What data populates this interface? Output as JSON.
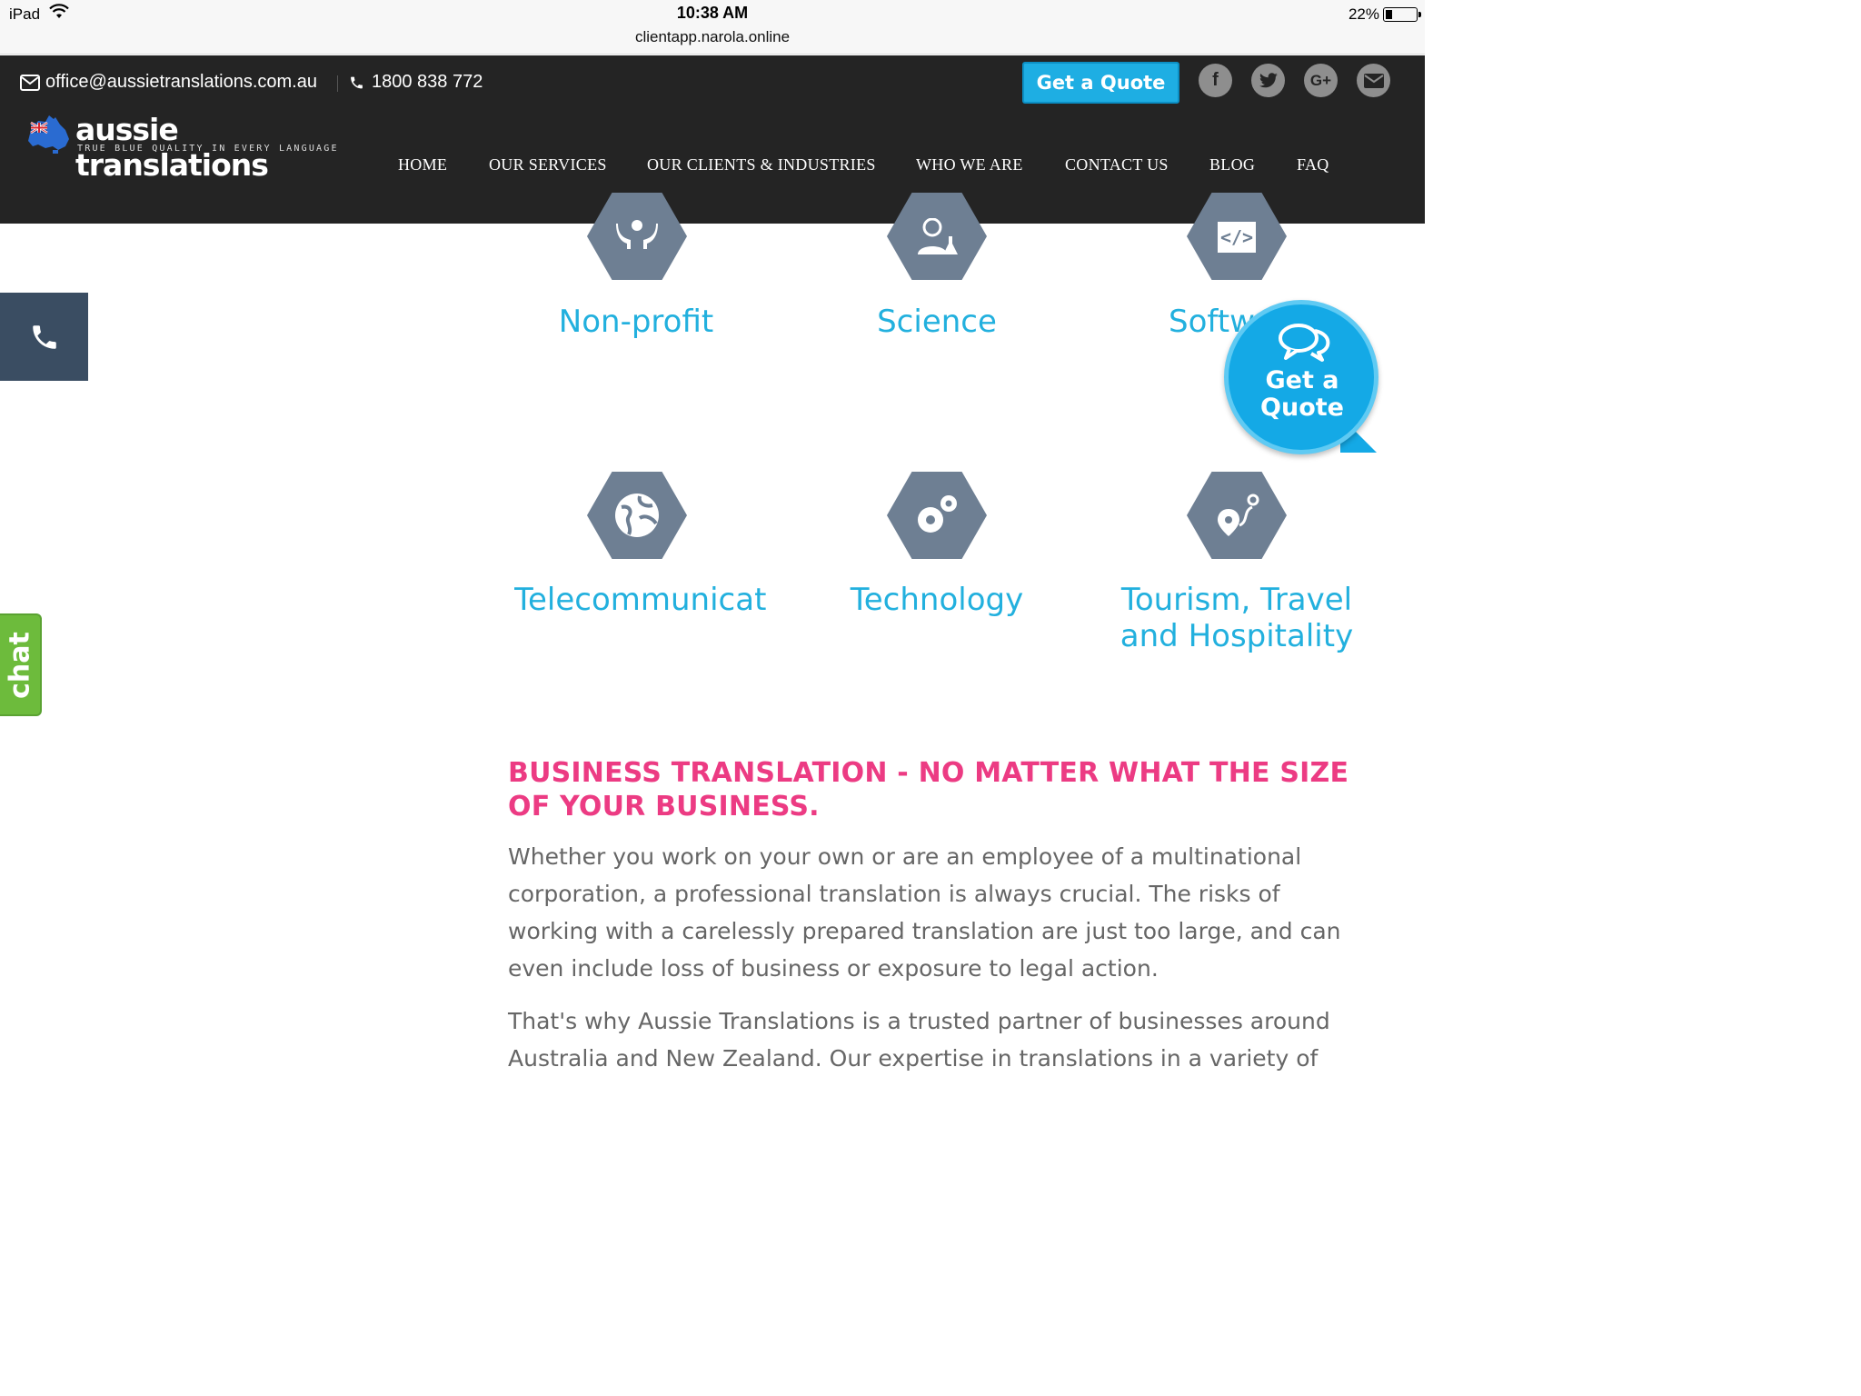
{
  "statusbar": {
    "device": "iPad",
    "time": "10:38 AM",
    "url": "clientapp.narola.online",
    "battery": "22%",
    "battery_level": 0.22
  },
  "header": {
    "email": "office@aussietranslations.com.au",
    "phone": "1800 838 772",
    "quote_button": "Get a Quote",
    "social": [
      "facebook-icon",
      "twitter-icon",
      "google-plus-icon",
      "mail-icon"
    ]
  },
  "logo": {
    "name": "aussie translations",
    "tagline": "TRUE BLUE QUALITY IN EVERY LANGUAGE"
  },
  "nav": {
    "items": [
      "HOME",
      "OUR SERVICES",
      "OUR CLIENTS & INDUSTRIES",
      "WHO WE ARE",
      "CONTACT US",
      "BLOG",
      "FAQ"
    ]
  },
  "industries": [
    {
      "label": "Non-profit",
      "icon": "hands-icon"
    },
    {
      "label": "Science",
      "icon": "scientist-icon"
    },
    {
      "label": "Software",
      "icon": "code-icon"
    },
    {
      "label": "Telecommunicati",
      "icon": "globe-icon"
    },
    {
      "label": "Technology",
      "icon": "gears-icon"
    },
    {
      "label_line1": "Tourism, Travel",
      "label_line2": "and Hospitality",
      "icon": "location-pin-icon"
    }
  ],
  "floating": {
    "quote_line1": "Get a",
    "quote_line2": "Quote",
    "chat": "chat"
  },
  "article": {
    "heading": "BUSINESS TRANSLATION - NO MATTER WHAT THE SIZE OF YOUR BUSINESS.",
    "p1": "Whether you work on your own or are an employee of a multinational corporation, a professional translation is always crucial. The risks of working with a carelessly prepared translation are just too large, and can even include loss of business or exposure to legal action.",
    "p2": "That's why Aussie Translations is a trusted partner of businesses around Australia and New Zealand. Our expertise in translations in a variety of"
  }
}
